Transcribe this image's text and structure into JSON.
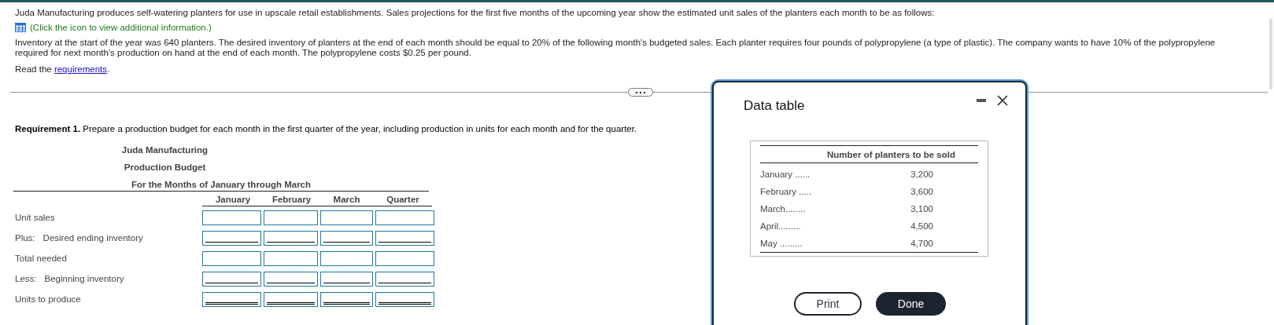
{
  "problem": {
    "intro": "Juda Manufacturing produces self-watering planters for use in upscale retail establishments. Sales projections for the first five months of the upcoming year show the estimated unit sales of the planters each month to be as follows:",
    "info_link": "(Click the icon to view additional information.)",
    "details": "Inventory at the start of the year was 640 planters. The desired inventory of planters at the end of each month should be equal to 20% of the following month's budgeted sales. Each planter requires four pounds of polypropylene (a type of plastic). The company wants to have 10% of the polypropylene required for next month's production on hand at the end of each month. The polypropylene costs $0.25 per pound.",
    "read_prefix": "Read the",
    "read_link": "requirements",
    "read_suffix": "."
  },
  "requirement": "**Requirement 1.** Prepare a production budget for each month in the first quarter of the year, including production in units for each month and for the quarter.",
  "budget": {
    "titles": [
      "Juda Manufacturing",
      "Production Budget",
      "For the Months of January through March"
    ],
    "columns": [
      "January",
      "February",
      "March",
      "Quarter"
    ],
    "rows": [
      {
        "prefix": "",
        "label": "Unit sales",
        "kind": "plain"
      },
      {
        "prefix": "Plus:",
        "label": "Desired ending inventory",
        "kind": "single"
      },
      {
        "prefix": "",
        "label": "Total needed",
        "kind": "plain"
      },
      {
        "prefix": "Less:",
        "label": "Beginning inventory",
        "kind": "single"
      },
      {
        "prefix": "",
        "label": "Units to produce",
        "kind": "double"
      }
    ]
  },
  "dialog": {
    "title": "Data table",
    "header": "Number of planters to be sold",
    "rows": [
      {
        "month": "January ......",
        "value": "3,200"
      },
      {
        "month": "February .....",
        "value": "3,600"
      },
      {
        "month": "March........",
        "value": "3,100"
      },
      {
        "month": "April.........",
        "value": "4,500"
      },
      {
        "month": "May .........",
        "value": "4,700"
      }
    ],
    "buttons": [
      {
        "label": "Print",
        "kind": "secondary"
      },
      {
        "label": "Done",
        "kind": "primary"
      }
    ]
  }
}
